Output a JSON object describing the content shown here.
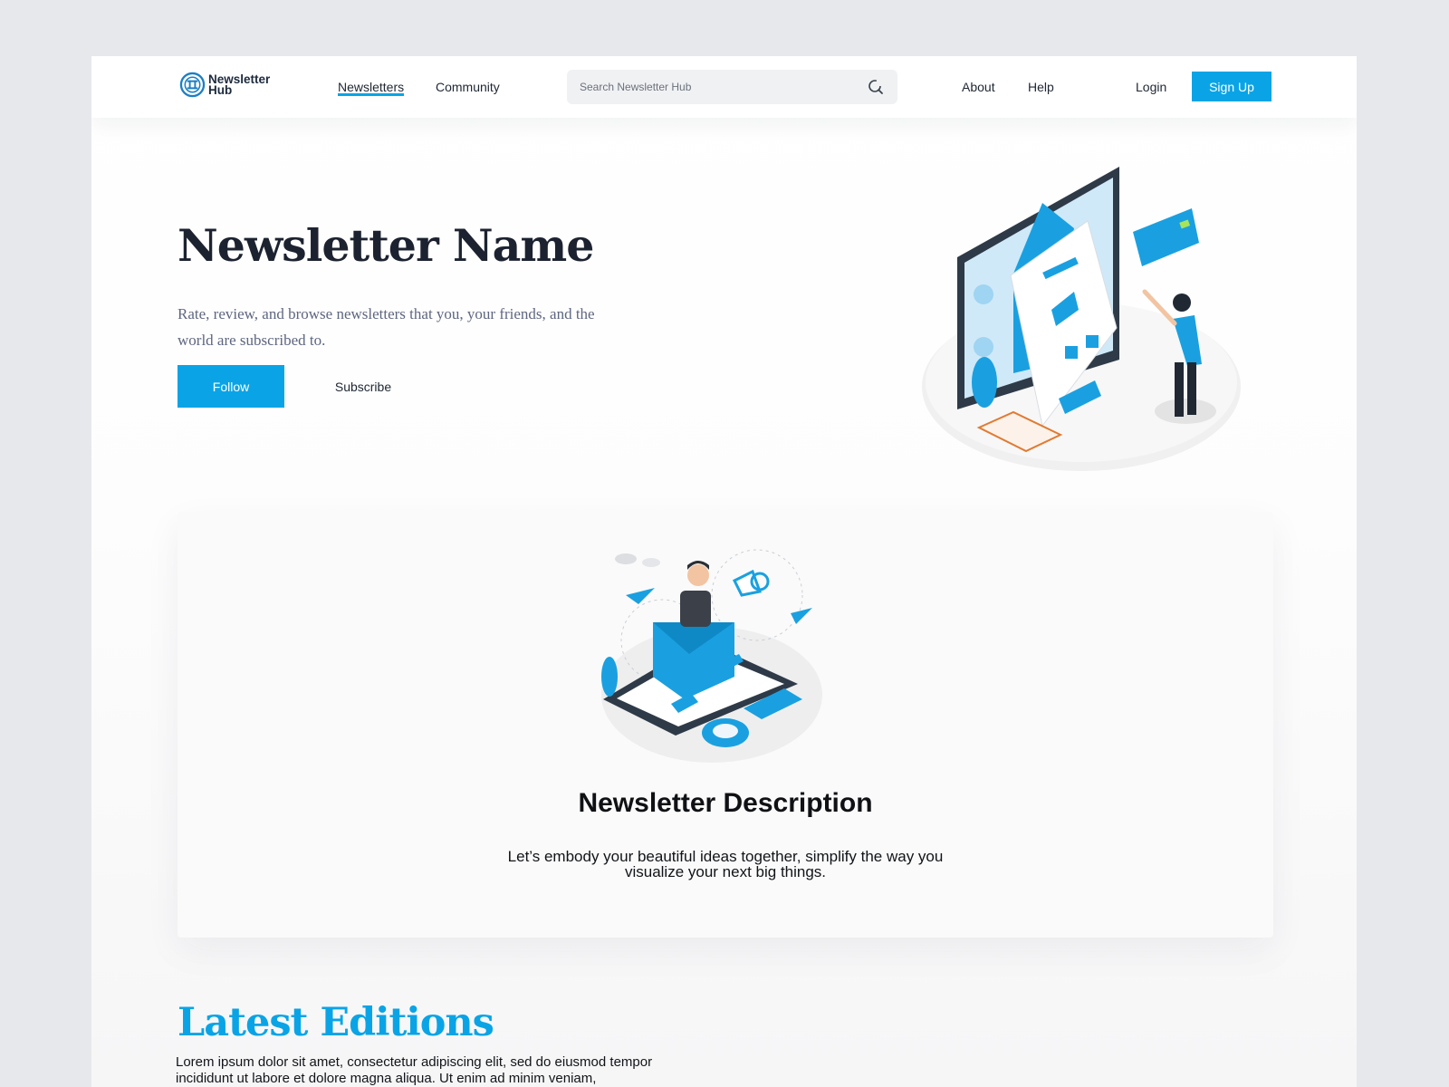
{
  "brand": {
    "name_line1": "Newsletter",
    "name_line2": "Hub"
  },
  "nav": {
    "links": [
      {
        "label": "Newsletters",
        "active": true
      },
      {
        "label": "Community",
        "active": false
      }
    ],
    "search": {
      "placeholder": "Search Newsletter Hub",
      "icon": "search-icon"
    },
    "right_links": [
      {
        "label": "About"
      },
      {
        "label": "Help"
      },
      {
        "label": "Login"
      }
    ],
    "signup_label": "Sign Up"
  },
  "hero": {
    "title": "Newsletter Name",
    "subtitle": "Rate, review, and browse newsletters that you, your friends, and the world are subscribed to.",
    "follow_label": "Follow",
    "subscribe_label": "Subscribe"
  },
  "description": {
    "title": "Newsletter Description",
    "body": "Let’s embody your beautiful ideas together, simplify the way you visualize your next big things."
  },
  "latest": {
    "title": "Latest Editions",
    "body": "Lorem ipsum dolor sit amet, consectetur adipiscing elit, sed do eiusmod tempor incididunt ut labore et dolore magna aliqua. Ut enim ad minim veniam,"
  },
  "colors": {
    "accent": "#0aa4e6",
    "text_dark": "#1c2230",
    "text_muted": "#5e6680",
    "page_bg": "#e6e8ec"
  }
}
